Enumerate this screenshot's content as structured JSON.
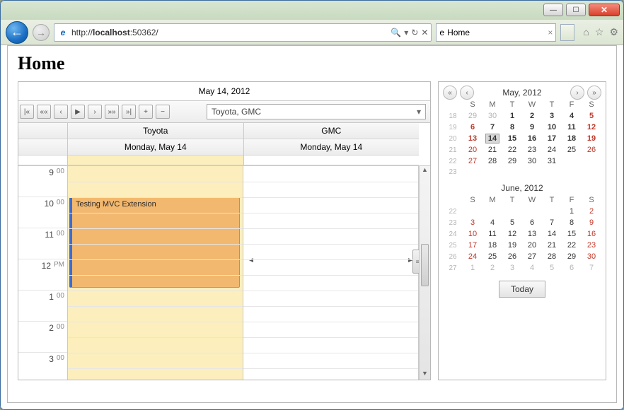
{
  "window": {
    "minimize": "—",
    "maximize": "☐",
    "close": "✕"
  },
  "browser": {
    "url_prefix": "http://",
    "url_host": "localhost",
    "url_port": ":50362/",
    "tab_title": "Home",
    "search_glyph": "🔍",
    "refresh_glyph": "↻",
    "stop_glyph": "✕",
    "sep_glyph": "▾",
    "home_glyph": "⌂",
    "star_glyph": "☆",
    "gear_glyph": "⚙"
  },
  "page": {
    "title": "Home"
  },
  "scheduler": {
    "date_title": "May 14, 2012",
    "dropdown": "Toyota, GMC",
    "nav": {
      "first": "|«",
      "fastprev": "««",
      "prev": "‹",
      "play": "▶",
      "next": "›",
      "fastnext": "»»",
      "last": "»|",
      "plus": "+",
      "minus": "−"
    },
    "columns": [
      {
        "name": "Toyota",
        "date": "Monday, May 14"
      },
      {
        "name": "GMC",
        "date": "Monday, May 14"
      }
    ],
    "times": [
      {
        "h": "9",
        "m": "00"
      },
      {
        "h": "10",
        "m": "00"
      },
      {
        "h": "11",
        "m": "00"
      },
      {
        "h": "12",
        "m": "PM"
      },
      {
        "h": "1",
        "m": "00"
      },
      {
        "h": "2",
        "m": "00"
      },
      {
        "h": "3",
        "m": "00"
      }
    ],
    "appointment": "Testing MVC Extension"
  },
  "calendar": {
    "may": {
      "title": "May, 2012",
      "dow": [
        "S",
        "M",
        "T",
        "W",
        "T",
        "F",
        "S"
      ],
      "weeks": [
        {
          "wk": "18",
          "d": [
            {
              "v": "29",
              "cls": "dim"
            },
            {
              "v": "30",
              "cls": "dim"
            },
            {
              "v": "1",
              "cls": "bold"
            },
            {
              "v": "2",
              "cls": "bold"
            },
            {
              "v": "3",
              "cls": "bold"
            },
            {
              "v": "4",
              "cls": "bold"
            },
            {
              "v": "5",
              "cls": "sun bold"
            }
          ]
        },
        {
          "wk": "19",
          "d": [
            {
              "v": "6",
              "cls": "sun bold"
            },
            {
              "v": "7",
              "cls": "bold"
            },
            {
              "v": "8",
              "cls": "bold"
            },
            {
              "v": "9",
              "cls": "bold"
            },
            {
              "v": "10",
              "cls": "bold"
            },
            {
              "v": "11",
              "cls": "bold"
            },
            {
              "v": "12",
              "cls": "sun bold"
            }
          ]
        },
        {
          "wk": "20",
          "d": [
            {
              "v": "13",
              "cls": "sun bold"
            },
            {
              "v": "14",
              "cls": "bold today"
            },
            {
              "v": "15",
              "cls": "bold"
            },
            {
              "v": "16",
              "cls": "bold"
            },
            {
              "v": "17",
              "cls": "bold"
            },
            {
              "v": "18",
              "cls": "bold"
            },
            {
              "v": "19",
              "cls": "sun bold"
            }
          ]
        },
        {
          "wk": "21",
          "d": [
            {
              "v": "20",
              "cls": "sun"
            },
            {
              "v": "21",
              "cls": ""
            },
            {
              "v": "22",
              "cls": ""
            },
            {
              "v": "23",
              "cls": ""
            },
            {
              "v": "24",
              "cls": ""
            },
            {
              "v": "25",
              "cls": ""
            },
            {
              "v": "26",
              "cls": "sun"
            }
          ]
        },
        {
          "wk": "22",
          "d": [
            {
              "v": "27",
              "cls": "sun"
            },
            {
              "v": "28",
              "cls": ""
            },
            {
              "v": "29",
              "cls": ""
            },
            {
              "v": "30",
              "cls": ""
            },
            {
              "v": "31",
              "cls": ""
            },
            {
              "v": "",
              "cls": ""
            },
            {
              "v": "",
              "cls": ""
            }
          ]
        },
        {
          "wk": "23",
          "d": [
            {
              "v": "",
              "cls": ""
            },
            {
              "v": "",
              "cls": ""
            },
            {
              "v": "",
              "cls": ""
            },
            {
              "v": "",
              "cls": ""
            },
            {
              "v": "",
              "cls": ""
            },
            {
              "v": "",
              "cls": ""
            },
            {
              "v": "",
              "cls": ""
            }
          ]
        }
      ]
    },
    "june": {
      "title": "June, 2012",
      "dow": [
        "S",
        "M",
        "T",
        "W",
        "T",
        "F",
        "S"
      ],
      "weeks": [
        {
          "wk": "22",
          "d": [
            {
              "v": "",
              "cls": ""
            },
            {
              "v": "",
              "cls": ""
            },
            {
              "v": "",
              "cls": ""
            },
            {
              "v": "",
              "cls": ""
            },
            {
              "v": "",
              "cls": ""
            },
            {
              "v": "1",
              "cls": ""
            },
            {
              "v": "2",
              "cls": "sun"
            }
          ]
        },
        {
          "wk": "23",
          "d": [
            {
              "v": "3",
              "cls": "sun"
            },
            {
              "v": "4",
              "cls": ""
            },
            {
              "v": "5",
              "cls": ""
            },
            {
              "v": "6",
              "cls": ""
            },
            {
              "v": "7",
              "cls": ""
            },
            {
              "v": "8",
              "cls": ""
            },
            {
              "v": "9",
              "cls": "sun"
            }
          ]
        },
        {
          "wk": "24",
          "d": [
            {
              "v": "10",
              "cls": "sun"
            },
            {
              "v": "11",
              "cls": ""
            },
            {
              "v": "12",
              "cls": ""
            },
            {
              "v": "13",
              "cls": ""
            },
            {
              "v": "14",
              "cls": ""
            },
            {
              "v": "15",
              "cls": ""
            },
            {
              "v": "16",
              "cls": "sun"
            }
          ]
        },
        {
          "wk": "25",
          "d": [
            {
              "v": "17",
              "cls": "sun"
            },
            {
              "v": "18",
              "cls": ""
            },
            {
              "v": "19",
              "cls": ""
            },
            {
              "v": "20",
              "cls": ""
            },
            {
              "v": "21",
              "cls": ""
            },
            {
              "v": "22",
              "cls": ""
            },
            {
              "v": "23",
              "cls": "sun"
            }
          ]
        },
        {
          "wk": "26",
          "d": [
            {
              "v": "24",
              "cls": "sun"
            },
            {
              "v": "25",
              "cls": ""
            },
            {
              "v": "26",
              "cls": ""
            },
            {
              "v": "27",
              "cls": ""
            },
            {
              "v": "28",
              "cls": ""
            },
            {
              "v": "29",
              "cls": ""
            },
            {
              "v": "30",
              "cls": "sun"
            }
          ]
        },
        {
          "wk": "27",
          "d": [
            {
              "v": "1",
              "cls": "dim"
            },
            {
              "v": "2",
              "cls": "dim"
            },
            {
              "v": "3",
              "cls": "dim"
            },
            {
              "v": "4",
              "cls": "dim"
            },
            {
              "v": "5",
              "cls": "dim"
            },
            {
              "v": "6",
              "cls": "dim"
            },
            {
              "v": "7",
              "cls": "dim"
            }
          ]
        }
      ]
    },
    "today_label": "Today"
  }
}
